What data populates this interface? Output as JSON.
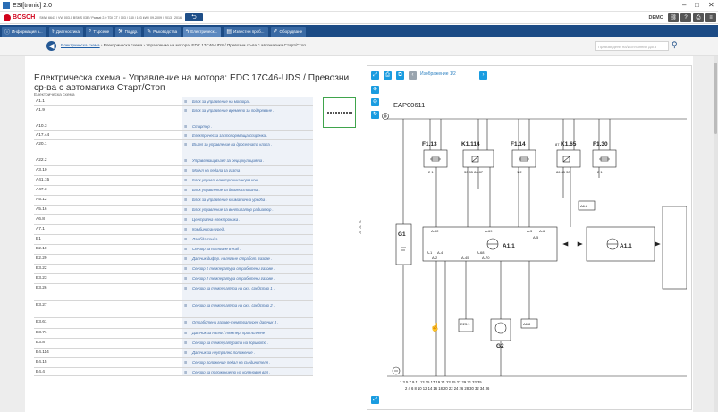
{
  "window": {
    "title": "ESI[tronic] 2.0",
    "controls": [
      "–",
      "□",
      "✕"
    ]
  },
  "header": {
    "brand": "BOSCH",
    "vehicle_info": "SMW 6641 / VW 003.0 BSMS 03E / Passat 2.0 TDI CT / 103 / 140 / 103 kW / 09.2009 / 2013 / 2016",
    "back_label": "⮌",
    "demo_label": "DEMO"
  },
  "tabs": [
    {
      "label": "Информация з...",
      "icon": "info-icon"
    },
    {
      "label": "Диагностика",
      "icon": "diagnosis-icon"
    },
    {
      "label": "Търсене",
      "icon": "search-icon"
    },
    {
      "label": "Поддр.",
      "icon": "wrench-icon"
    },
    {
      "label": "Ръководства",
      "icon": "manual-icon"
    },
    {
      "label": "Електрическ...",
      "icon": "lightning-icon",
      "active": true
    },
    {
      "label": "Известни проб...",
      "icon": "book-icon"
    },
    {
      "label": "Оборудване",
      "icon": "equipment-icon"
    }
  ],
  "breadcrumb": {
    "link": "Електрическа схема",
    "rest": " › Електрическа схема › Управление на мотора: EDC 17C46-UDS / Превозни ср-ва с автоматика Старт/Стоп"
  },
  "search": {
    "placeholder": "Произведени на/Изтегляния дата"
  },
  "page": {
    "title": "Електрическа схема - Управление на мотора: EDC 17C46-UDS / Превозни ср-ва с автоматика Старт/Стоп",
    "subtitle": "Електрическа схема"
  },
  "components": [
    {
      "code": "A1.1",
      "desc": "Блок за управление на мотора ."
    },
    {
      "code": "A1.9",
      "desc": "Блок за управление времето за подгряване ."
    },
    {
      "code": "A10.3",
      "desc": "Стартер ."
    },
    {
      "code": "A17.44",
      "desc": "Електрическа застопоряваща спирачка ."
    },
    {
      "code": "A20.1",
      "desc": "Възел за управление на дроселната клапа ."
    },
    {
      "code": "A22.2",
      "desc": "Управляващ възел за рециркулацията ."
    },
    {
      "code": "A3.10",
      "desc": "Модул на педала за газта ."
    },
    {
      "code": "A41.15",
      "desc": "Блок управл. електроника норм.кон. ."
    },
    {
      "code": "A47.3",
      "desc": "Блок управление за диагностиката ."
    },
    {
      "code": "A5.12",
      "desc": "Блок за управление климатична уредба ."
    },
    {
      "code": "A5.16",
      "desc": "Блок управление за вентилатор радиатор ."
    },
    {
      "code": "A6.8",
      "desc": "Централна електроника ."
    },
    {
      "code": "A7.1",
      "desc": "Комбиниран уред ."
    },
    {
      "code": "B1",
      "desc": "Ламбда сонда ."
    },
    {
      "code": "B2.10",
      "desc": "Сензор за налягане в Rail ."
    },
    {
      "code": "B2.29",
      "desc": "Датчик дифер. налягане отработ. газове ."
    },
    {
      "code": "B3.22",
      "desc": "Сензор 1 температура отработени газове ."
    },
    {
      "code": "B3.23",
      "desc": "Сензор 2 температура отработени газове ."
    },
    {
      "code": "B3.26",
      "desc": "Сензор за температура на охл. средство 1 ."
    },
    {
      "code": "B3.27",
      "desc": "Сензор за температура на охл. средство 2 ."
    },
    {
      "code": "B3.61",
      "desc": "Отработени газове-температурен датчик 3 ."
    },
    {
      "code": "B3.71",
      "desc": "Датчик за наляг./ темпер. при пълнене ."
    },
    {
      "code": "B3.8",
      "desc": "Сензор за температурата на горивото ."
    },
    {
      "code": "B4.114",
      "desc": "Датчик за неутрално положение ."
    },
    {
      "code": "B4.15",
      "desc": "Сензор положение педал на съединителя ."
    },
    {
      "code": "B4.4",
      "desc": "Сензор за положението на коляновия вал ."
    }
  ],
  "viewer": {
    "image_nav": "Изображение 1/2",
    "diagram_id": "EAP00611",
    "fuses": [
      "F1.13",
      "K1.114",
      "F1.14",
      "K1.65",
      "F1.30"
    ],
    "pins": {
      "f113": "2   1",
      "k1114": "30  85  86  87",
      "f114": "1   2",
      "k165": "86  85  30",
      "f130": "2   1"
    },
    "ecu_label": "A1.1",
    "ecu_pins": [
      "A-92",
      "A-1",
      "A-4",
      "A-2",
      "A-45",
      "A-69",
      "A-68",
      "A-70",
      "A-3",
      "A-6",
      "A-5"
    ],
    "g1": "G1",
    "g2": "G2",
    "small_boxes": [
      "A6.8",
      "E23.1",
      "A6.8"
    ],
    "rel_label": "87",
    "bottom_row1": "1     3     5     7     9    11    13    15    17    19    21    23    25    27    29    31    33    35",
    "bottom_row2": "2     4     6     8    10    12    14    16    18    20    22    24    26    28    30    32    34    36"
  },
  "colors": {
    "tab_bar": "#1c4b85",
    "accent": "#1a9ce0",
    "brand": "#d0021b",
    "thumb_border": "#3fa44c"
  }
}
